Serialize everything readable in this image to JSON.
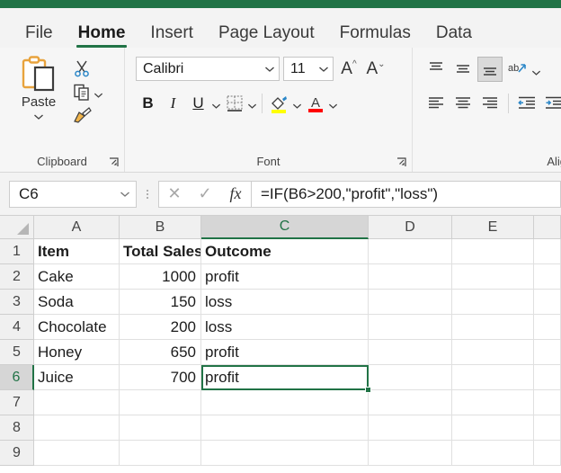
{
  "window": {
    "accent_color": "#217346"
  },
  "ribbon": {
    "tabs": [
      {
        "label": "File",
        "active": false
      },
      {
        "label": "Home",
        "active": true
      },
      {
        "label": "Insert",
        "active": false
      },
      {
        "label": "Page Layout",
        "active": false
      },
      {
        "label": "Formulas",
        "active": false
      },
      {
        "label": "Data",
        "active": false
      }
    ],
    "clipboard": {
      "group_label": "Clipboard",
      "paste_label": "Paste",
      "cut_name": "cut-icon",
      "copy_name": "copy-icon",
      "format_painter_name": "format-painter-icon"
    },
    "font": {
      "group_label": "Font",
      "font_name": "Calibri",
      "font_size": "11",
      "grow_font": "A",
      "shrink_font": "A",
      "bold": "B",
      "italic": "I",
      "underline": "U",
      "fill_color": "#ffff00",
      "font_color": "#ff0000"
    },
    "alignment": {
      "group_label": "Alig"
    }
  },
  "formula_bar": {
    "name_box": "C6",
    "cancel": "✕",
    "enter": "✓",
    "fx": "fx",
    "formula": "=IF(B6>200,\"profit\",\"loss\")"
  },
  "sheet": {
    "columns": [
      "A",
      "B",
      "C",
      "D",
      "E"
    ],
    "selected_column": "C",
    "rows": [
      "1",
      "2",
      "3",
      "4",
      "5",
      "6",
      "7",
      "8",
      "9"
    ],
    "selected_row": "6",
    "selected_cell": "C6",
    "data": [
      {
        "a": "Item",
        "b": "Total Sales",
        "c": "Outcome",
        "bold": true,
        "b_numeric": false
      },
      {
        "a": "Cake",
        "b": "1000",
        "c": "profit",
        "bold": false,
        "b_numeric": true
      },
      {
        "a": "Soda",
        "b": "150",
        "c": "loss",
        "bold": false,
        "b_numeric": true
      },
      {
        "a": "Chocolate",
        "b": "200",
        "c": "loss",
        "bold": false,
        "b_numeric": true
      },
      {
        "a": "Honey",
        "b": "650",
        "c": "profit",
        "bold": false,
        "b_numeric": true
      },
      {
        "a": "Juice",
        "b": "700",
        "c": "profit",
        "bold": false,
        "b_numeric": true
      },
      {
        "a": "",
        "b": "",
        "c": "",
        "bold": false,
        "b_numeric": false
      },
      {
        "a": "",
        "b": "",
        "c": "",
        "bold": false,
        "b_numeric": false
      },
      {
        "a": "",
        "b": "",
        "c": "",
        "bold": false,
        "b_numeric": false
      }
    ]
  }
}
